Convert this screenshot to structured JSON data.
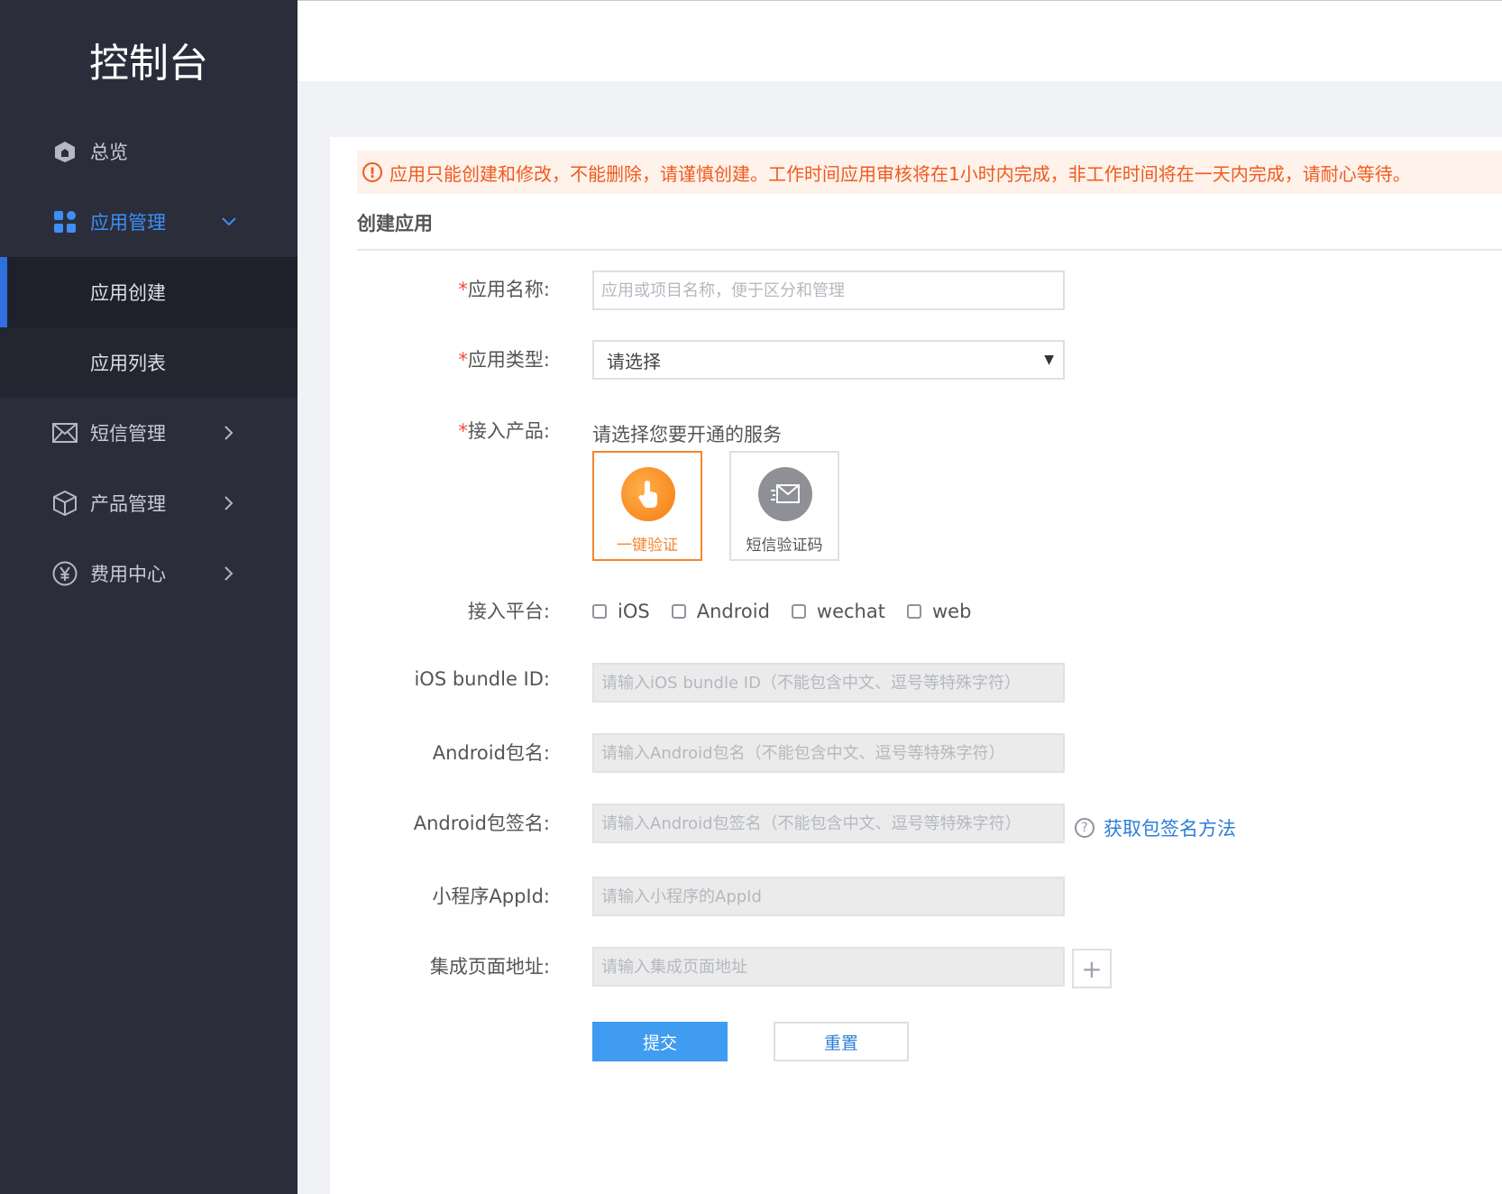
{
  "sidebar": {
    "title": "控制台",
    "items": [
      {
        "label": "总览",
        "icon": "home-icon"
      },
      {
        "label": "应用管理",
        "icon": "grid-icon"
      },
      {
        "label": "短信管理",
        "icon": "mail-icon"
      },
      {
        "label": "产品管理",
        "icon": "cube-icon"
      },
      {
        "label": "费用中心",
        "icon": "yen-icon"
      }
    ],
    "sub_items": [
      {
        "label": "应用创建"
      },
      {
        "label": "应用列表"
      }
    ]
  },
  "alert": {
    "text": "应用只能创建和修改，不能删除，请谨慎创建。工作时间应用审核将在1小时内完成，非工作时间将在一天内完成，请耐心等待。"
  },
  "form": {
    "section_title": "创建应用",
    "app_name": {
      "required": "*",
      "label": "应用名称:",
      "placeholder": "应用或项目名称，便于区分和管理"
    },
    "app_type": {
      "required": "*",
      "label": "应用类型:",
      "value": "请选择"
    },
    "product": {
      "required": "*",
      "label": "接入产品:",
      "hint": "请选择您要开通的服务",
      "options": [
        {
          "name": "一键验证",
          "icon": "tap-icon",
          "selected": true
        },
        {
          "name": "短信验证码",
          "icon": "envelope-icon",
          "selected": false
        }
      ]
    },
    "platform": {
      "label": "接入平台:",
      "options": [
        "iOS",
        "Android",
        "wechat",
        "web"
      ]
    },
    "ios_bundle": {
      "label": "iOS bundle ID:",
      "placeholder": "请输入iOS bundle ID（不能包含中文、逗号等特殊字符）"
    },
    "android_pkg": {
      "label": "Android包名:",
      "placeholder": "请输入Android包名（不能包含中文、逗号等特殊字符）"
    },
    "android_sign": {
      "label": "Android包签名:",
      "placeholder": "请输入Android包签名（不能包含中文、逗号等特殊字符）",
      "help": "获取包签名方法"
    },
    "mini_appid": {
      "label": "小程序AppId:",
      "placeholder": "请输入小程序的AppId"
    },
    "page_url": {
      "label": "集成页面地址:",
      "placeholder": "请输入集成页面地址"
    },
    "submit_label": "提交",
    "reset_label": "重置"
  },
  "colors": {
    "accent": "#3d8ff5",
    "warning": "#f05a1e",
    "selected_card": "#f5862e",
    "sidebar_bg": "#2b2d3b"
  }
}
